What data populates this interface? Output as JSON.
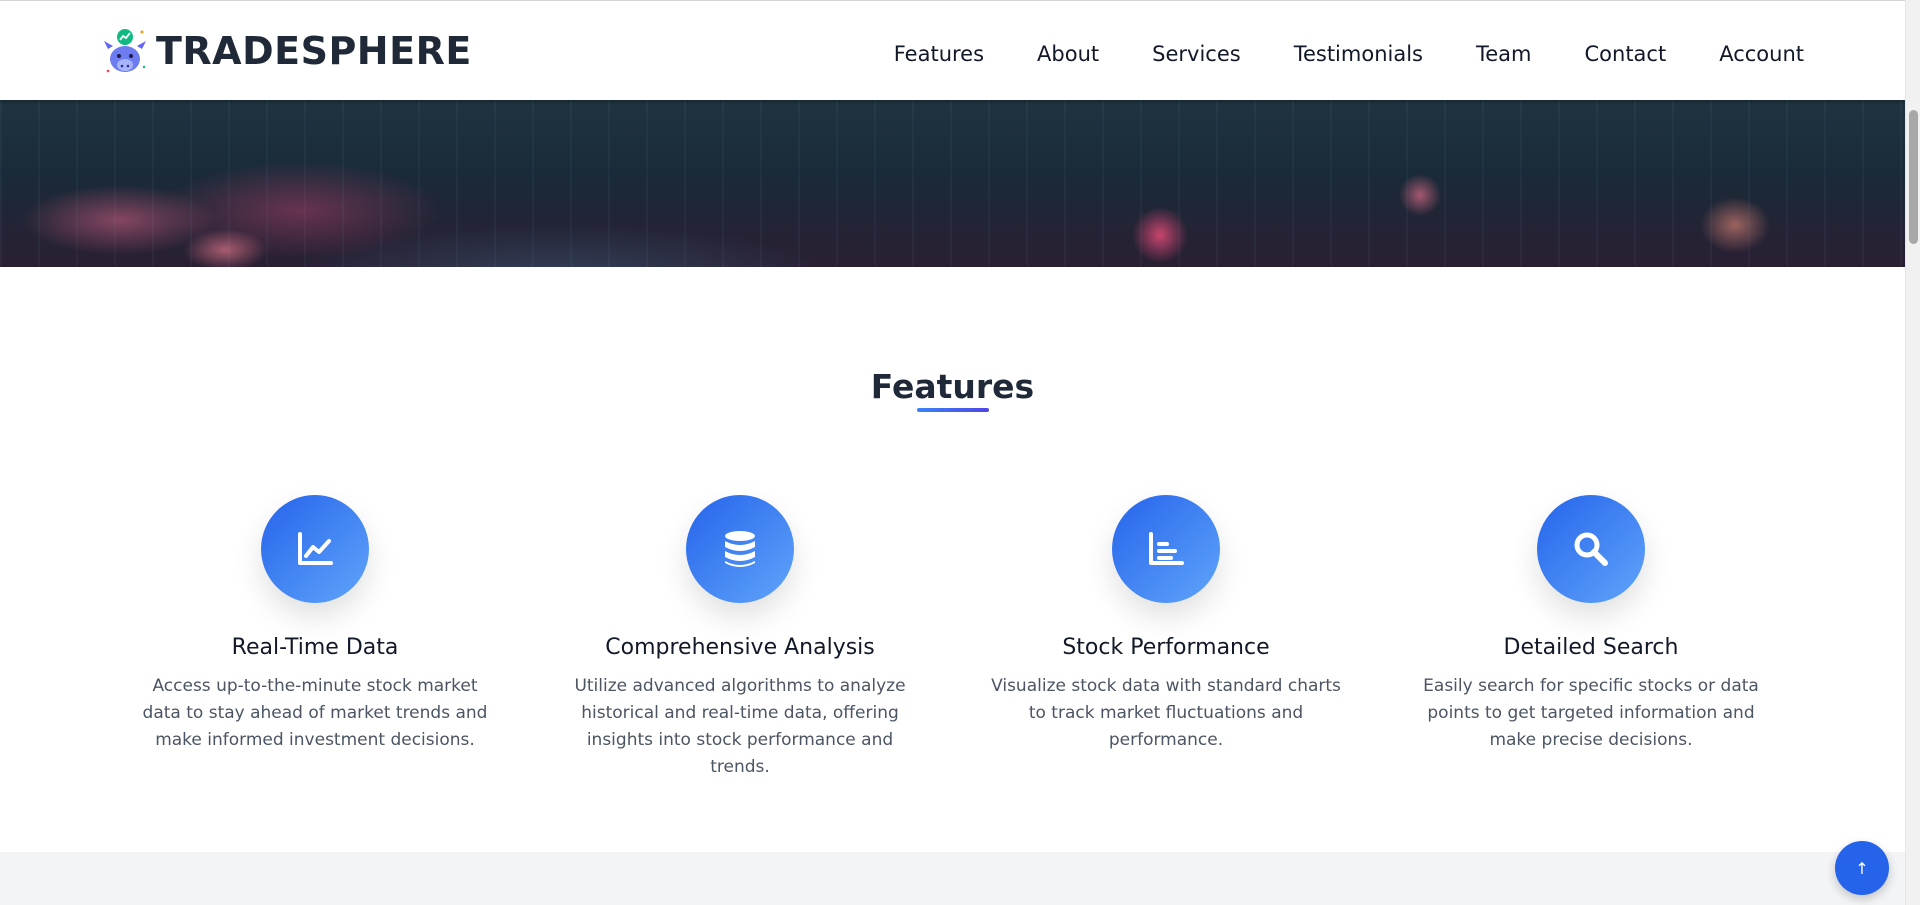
{
  "header": {
    "brand": "TRADESPHERE",
    "logo_icon": "bull-trend-icon",
    "nav": [
      {
        "label": "Features"
      },
      {
        "label": "About"
      },
      {
        "label": "Services"
      },
      {
        "label": "Testimonials"
      },
      {
        "label": "Team"
      },
      {
        "label": "Contact"
      },
      {
        "label": "Account"
      }
    ]
  },
  "features": {
    "title": "Features",
    "accent_color": "#2563eb",
    "cards": [
      {
        "icon": "line-chart-icon",
        "title": "Real-Time Data",
        "text": "Access up-to-the-minute stock market data to stay ahead of market trends and make informed investment decisions."
      },
      {
        "icon": "database-icon",
        "title": "Comprehensive Analysis",
        "text": "Utilize advanced algorithms to analyze historical and real-time data, offering insights into stock performance and trends."
      },
      {
        "icon": "bar-chart-icon",
        "title": "Stock Performance",
        "text": "Visualize stock data with standard charts to track market fluctuations and performance."
      },
      {
        "icon": "search-icon",
        "title": "Detailed Search",
        "text": "Easily search for specific stocks or data points to get targeted information and make precise decisions."
      }
    ]
  },
  "scroll_top": {
    "label": "↑"
  }
}
